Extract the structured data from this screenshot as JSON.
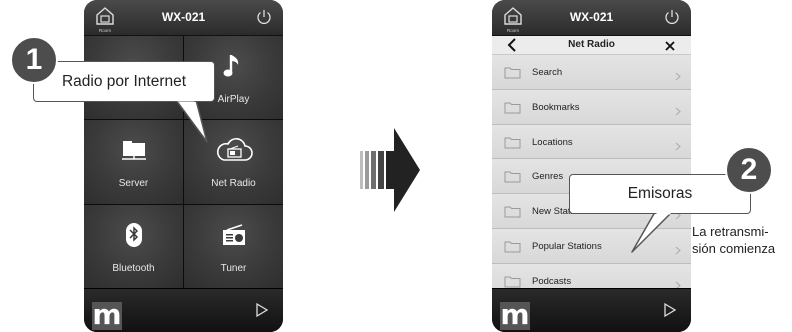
{
  "left_screen": {
    "device_name": "WX-021",
    "home_label": "Room",
    "tiles": [
      {
        "label": "",
        "icon": "media-icon"
      },
      {
        "label": "AirPlay",
        "icon": "music-note-icon"
      },
      {
        "label": "Server",
        "icon": "folder-icon"
      },
      {
        "label": "Net Radio",
        "icon": "cloud-radio-icon"
      },
      {
        "label": "Bluetooth",
        "icon": "bluetooth-icon"
      },
      {
        "label": "Tuner",
        "icon": "radio-icon"
      }
    ],
    "callout": {
      "number": "1",
      "text": "Radio por Internet"
    }
  },
  "right_screen": {
    "device_name": "WX-021",
    "home_label": "Room",
    "nav_title": "Net Radio",
    "list_items": [
      {
        "label": "Search"
      },
      {
        "label": "Bookmarks"
      },
      {
        "label": "Locations"
      },
      {
        "label": "Genres"
      },
      {
        "label": "New Stations"
      },
      {
        "label": "Popular Stations"
      },
      {
        "label": "Podcasts"
      }
    ],
    "callout": {
      "number": "2",
      "text": "Emisoras"
    }
  },
  "caption": "La retransmi- sión comienza",
  "colors": {
    "badge": "#4d4d4d",
    "status_bar": "#3a3a3a",
    "arrow": "#222222",
    "list_bg": "#dedede"
  }
}
